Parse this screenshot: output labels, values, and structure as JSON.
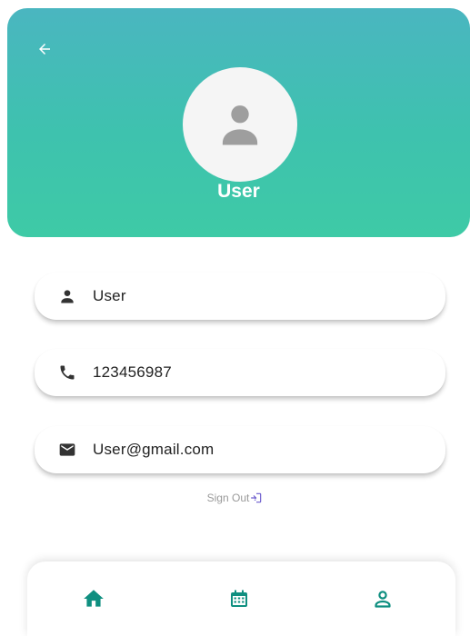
{
  "colors": {
    "header_gradient_top": "#4ab6c0",
    "header_gradient_bottom": "#3ecaa6",
    "accent": "#0f8f80",
    "icon_dark": "#333333",
    "muted_text": "#9a9a9a",
    "signout_icon": "#6a5acd"
  },
  "header": {
    "back_icon": "arrow-left-icon",
    "avatar_icon": "person-icon",
    "name": "User"
  },
  "fields": [
    {
      "icon": "person-icon",
      "value": "User"
    },
    {
      "icon": "phone-icon",
      "value": "123456987"
    },
    {
      "icon": "email-icon",
      "value": "User@gmail.com"
    }
  ],
  "signout": {
    "label": "Sign Out",
    "icon": "login-icon"
  },
  "bottom_nav": {
    "items": [
      {
        "icon": "home-icon"
      },
      {
        "icon": "calendar-icon"
      },
      {
        "icon": "profile-icon",
        "active": true
      }
    ]
  }
}
